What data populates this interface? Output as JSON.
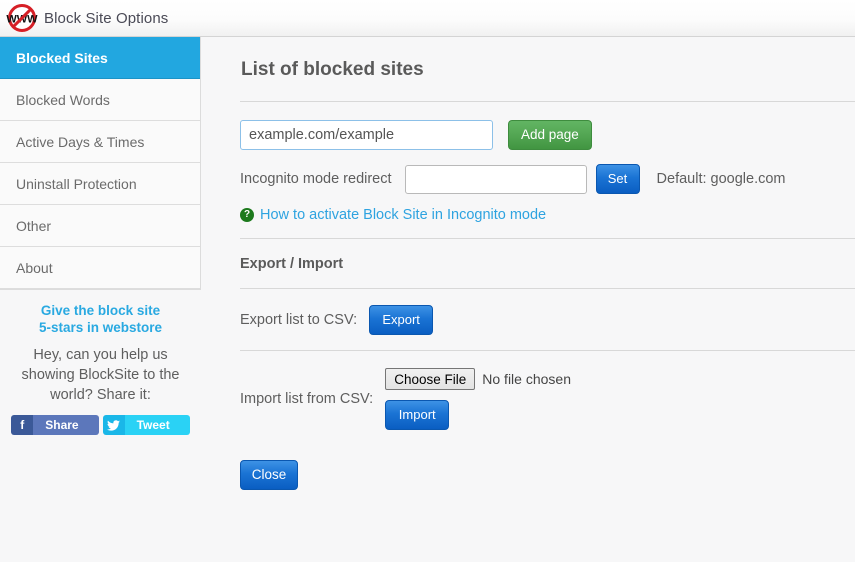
{
  "header": {
    "title": "Block Site Options",
    "logo_icon": "no-www-icon"
  },
  "sidebar": {
    "items": [
      {
        "label": "Blocked Sites",
        "active": true
      },
      {
        "label": "Blocked Words",
        "active": false
      },
      {
        "label": "Active Days & Times",
        "active": false
      },
      {
        "label": "Uninstall Protection",
        "active": false
      },
      {
        "label": "Other",
        "active": false
      },
      {
        "label": "About",
        "active": false
      }
    ],
    "promo": {
      "link_line1": "Give the block site",
      "link_line2": "5-stars in webstore",
      "text": "Hey, can you help us showing BlockSite to the world? Share it:",
      "facebook_label": "Share",
      "facebook_icon": "facebook-icon",
      "facebook_glyph": "f",
      "twitter_label": "Tweet",
      "twitter_icon": "twitter-icon"
    }
  },
  "main": {
    "blocked_sites": {
      "title": "List of blocked sites",
      "site_input_value": "example.com/example",
      "site_input_placeholder": "example.com/example",
      "add_page_label": "Add page"
    },
    "incognito": {
      "label": "Incognito mode redirect",
      "input_value": "",
      "input_placeholder": "",
      "set_label": "Set",
      "default_text": "Default: google.com",
      "help_icon": "question-mark-icon",
      "help_glyph": "?",
      "help_link": "How to activate Block Site in Incognito mode"
    },
    "export_import": {
      "title": "Export / Import",
      "export_label": "Export list to CSV:",
      "export_button": "Export",
      "import_label": "Import list from CSV:",
      "choose_file_button": "Choose File",
      "no_file_text": "No file chosen",
      "import_button": "Import"
    },
    "close_label": "Close"
  },
  "colors": {
    "accent_blue": "#22a7e0",
    "button_blue": "#1a73d4",
    "button_green": "#53a653",
    "link_blue": "#2ea3e0",
    "help_green": "#1d7a1d",
    "facebook": "#3b5998",
    "twitter": "#2ad2f5",
    "page_bg": "#f7f7f8"
  }
}
